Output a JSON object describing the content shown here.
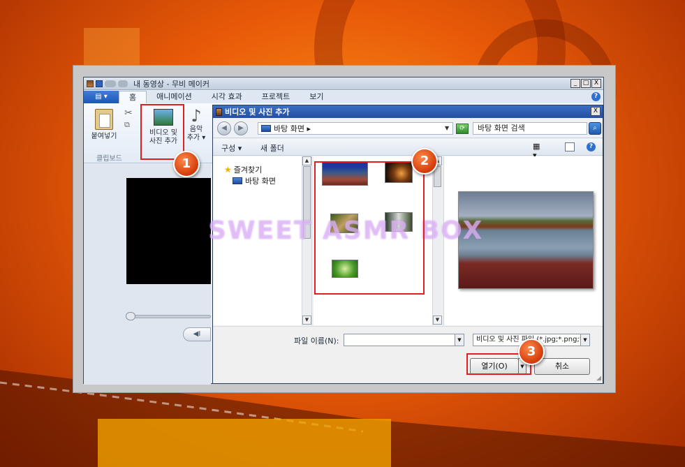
{
  "app": {
    "title": "내 동영상 - 무비 메이커",
    "window_controls": [
      "_",
      "□",
      "X"
    ],
    "file_tab_label": "▤ ▾",
    "tabs": [
      {
        "label": "홈",
        "active": true
      },
      {
        "label": "애니메이션",
        "active": false
      },
      {
        "label": "시각 효과",
        "active": false
      },
      {
        "label": "프로젝트",
        "active": false
      },
      {
        "label": "보기",
        "active": false
      }
    ],
    "help": "?",
    "ribbon": {
      "paste_label": "붙여넣기",
      "add_media_line1": "비디오 및",
      "add_media_line2": "사진 추가",
      "music_line1": "음악",
      "music_line2": "추가 ▾",
      "clipboard_group": "클립보드"
    },
    "player": {
      "prev_symbol": "◀I"
    }
  },
  "dialog": {
    "title": "비디오 및 사진 추가",
    "close": "X",
    "back": "◀",
    "forward": "▶",
    "address": "바탕 화면 ▸",
    "address_dropdown": "▼",
    "refresh": "⟳",
    "search_placeholder": "바탕 화면 검색",
    "search_icon": "search-icon",
    "commands": {
      "organize": "구성 ▾",
      "new_folder": "새 폴더"
    },
    "nav": {
      "favorites": "즐겨찾기",
      "desktop": "바탕 화면"
    },
    "file_name_label": "파일 이름(N):",
    "file_name_value": "",
    "file_type": "비디오 및 사진 파일 (*.jpg;*.png;*.bmp)",
    "open_label": "열기(O)",
    "cancel_label": "취소",
    "help": "?"
  },
  "annotations": {
    "step1": "1",
    "step2": "2",
    "step3": "3"
  },
  "watermark": "SWEET ASMR BOX",
  "colors": {
    "highlight": "#e02020",
    "badge": "#e0501a",
    "dialog_title": "#2f5fb3"
  }
}
